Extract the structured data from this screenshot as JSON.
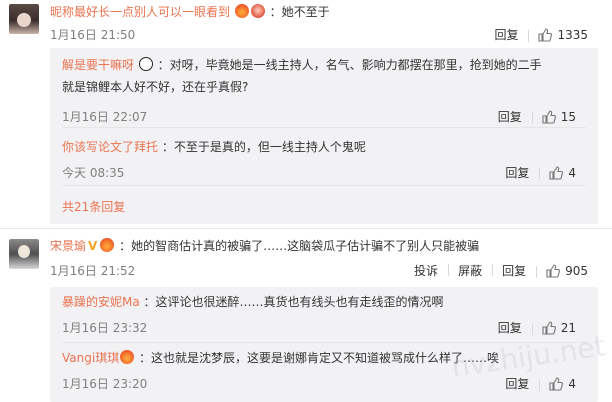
{
  "comments": [
    {
      "user": "昵称最好长一点别人可以一眼看到",
      "emoji": [
        "fire",
        "red-face"
      ],
      "text": "：她不至于",
      "date": "1月16日 21:50",
      "reply_label": "回复",
      "likes": "1335",
      "replies": [
        {
          "user": "解是要干嘛呀",
          "emoji": [
            "panda"
          ],
          "text_line1": "：对呀，毕竟她是一线主持人，名气、影响力都摆在那里，抢到她的二手",
          "text_line2": "就是锦鲤本人好不好，还在乎真假?",
          "date": "1月16日 22:07",
          "reply_label": "回复",
          "likes": "15"
        },
        {
          "user": "你该写论文了拜托",
          "text": "：不至于是真的，但一线主持人个鬼呢",
          "date": "今天 08:35",
          "reply_label": "回复",
          "likes": "4"
        }
      ],
      "more_replies": "共21条回复"
    },
    {
      "user": "宋景瑜",
      "badge": "V",
      "emoji": [
        "fire"
      ],
      "text": "：她的智商估计真的被骗了……这脑袋瓜子估计骗不了别人只能被骗",
      "date": "1月16日 21:52",
      "report_label": "投诉",
      "block_label": "屏蔽",
      "reply_label": "回复",
      "likes": "905",
      "replies": [
        {
          "user": "暴躁的安妮Ma",
          "text": "：这评论也很迷醉……真货也有线头也有走线歪的情况啊",
          "date": "1月16日 23:32",
          "reply_label": "回复",
          "likes": "21"
        },
        {
          "user": "Vangi琪琪",
          "emoji": [
            "fire"
          ],
          "text": "：这也就是沈梦辰，这要是谢娜肯定又不知道被骂成什么样了……唉",
          "date": "1月16日 23:20",
          "reply_label": "回复",
          "likes": "4"
        }
      ]
    }
  ],
  "watermark": "nvzhiju.net",
  "colors": {
    "username": "#eb7350",
    "date": "#808080",
    "reply_bg": "#f2f2f5"
  }
}
